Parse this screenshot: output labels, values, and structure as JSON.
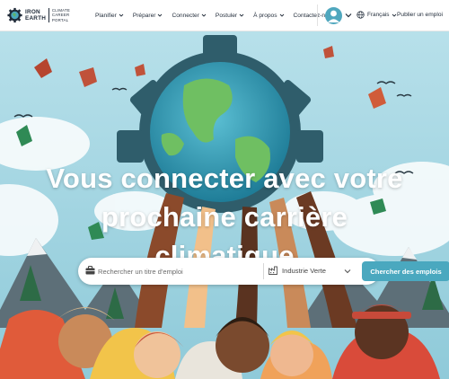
{
  "brand": {
    "name_lines": [
      "IRON",
      "EARTH"
    ],
    "tagline_lines": [
      "CLIMATE",
      "CAREER",
      "PORTAL"
    ]
  },
  "nav": {
    "items": [
      {
        "label": "Planifier",
        "has_menu": true
      },
      {
        "label": "Préparer",
        "has_menu": true
      },
      {
        "label": "Connecter",
        "has_menu": true
      },
      {
        "label": "Postuler",
        "has_menu": true
      },
      {
        "label": "À propos",
        "has_menu": true
      },
      {
        "label": "Contactez-nous",
        "has_menu": false
      }
    ]
  },
  "account": {
    "avatar_icon": "user-avatar-icon",
    "menu_icon": "chevron-down-icon"
  },
  "language": {
    "label": "Français",
    "icon": "globe-icon"
  },
  "publish_link": "Publier un emploi",
  "hero": {
    "headline_lines": [
      "Vous connecter avec votre",
      "prochaine carrière",
      "climatique"
    ]
  },
  "search": {
    "keyword_placeholder": "Rechercher un titre d'emploi",
    "industry_selected": "Industrie Verte",
    "button_label": "Chercher des emplois",
    "keyword_icon": "briefcase-icon",
    "industry_icon": "industry-icon"
  },
  "colors": {
    "accent": "#4aa8bf",
    "sky": "#a8d8e4",
    "text": "#1f2a38",
    "gear": "#2f5d6b"
  }
}
